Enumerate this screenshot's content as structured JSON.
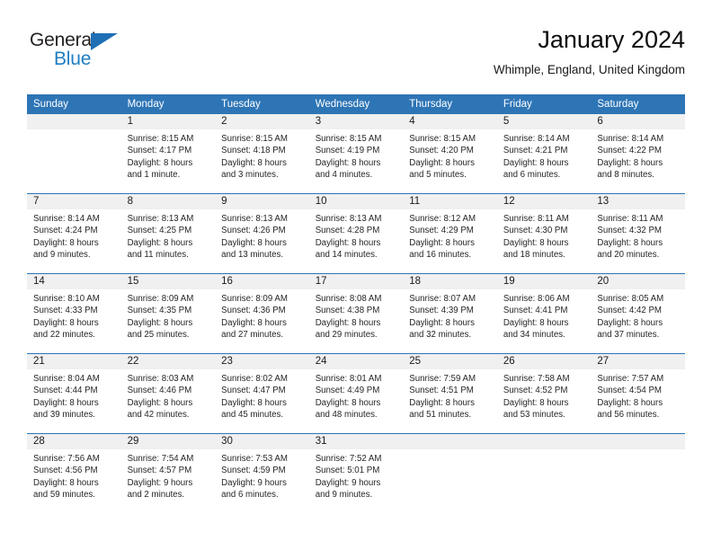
{
  "brand": {
    "name_part1": "General",
    "name_part2": "Blue",
    "triangle_icon": "triangle-icon",
    "accent_color": "#1f7ec4"
  },
  "header": {
    "title": "January 2024",
    "location": "Whimple, England, United Kingdom"
  },
  "calendar": {
    "header_bg": "#2e75b6",
    "daynum_band_bg": "#f0f0f0",
    "weekdays": [
      "Sunday",
      "Monday",
      "Tuesday",
      "Wednesday",
      "Thursday",
      "Friday",
      "Saturday"
    ],
    "weeks": [
      [
        {
          "day": "",
          "sunrise": "",
          "sunset": "",
          "daylight_line1": "",
          "daylight_line2": ""
        },
        {
          "day": "1",
          "sunrise": "Sunrise: 8:15 AM",
          "sunset": "Sunset: 4:17 PM",
          "daylight_line1": "Daylight: 8 hours",
          "daylight_line2": "and 1 minute."
        },
        {
          "day": "2",
          "sunrise": "Sunrise: 8:15 AM",
          "sunset": "Sunset: 4:18 PM",
          "daylight_line1": "Daylight: 8 hours",
          "daylight_line2": "and 3 minutes."
        },
        {
          "day": "3",
          "sunrise": "Sunrise: 8:15 AM",
          "sunset": "Sunset: 4:19 PM",
          "daylight_line1": "Daylight: 8 hours",
          "daylight_line2": "and 4 minutes."
        },
        {
          "day": "4",
          "sunrise": "Sunrise: 8:15 AM",
          "sunset": "Sunset: 4:20 PM",
          "daylight_line1": "Daylight: 8 hours",
          "daylight_line2": "and 5 minutes."
        },
        {
          "day": "5",
          "sunrise": "Sunrise: 8:14 AM",
          "sunset": "Sunset: 4:21 PM",
          "daylight_line1": "Daylight: 8 hours",
          "daylight_line2": "and 6 minutes."
        },
        {
          "day": "6",
          "sunrise": "Sunrise: 8:14 AM",
          "sunset": "Sunset: 4:22 PM",
          "daylight_line1": "Daylight: 8 hours",
          "daylight_line2": "and 8 minutes."
        }
      ],
      [
        {
          "day": "7",
          "sunrise": "Sunrise: 8:14 AM",
          "sunset": "Sunset: 4:24 PM",
          "daylight_line1": "Daylight: 8 hours",
          "daylight_line2": "and 9 minutes."
        },
        {
          "day": "8",
          "sunrise": "Sunrise: 8:13 AM",
          "sunset": "Sunset: 4:25 PM",
          "daylight_line1": "Daylight: 8 hours",
          "daylight_line2": "and 11 minutes."
        },
        {
          "day": "9",
          "sunrise": "Sunrise: 8:13 AM",
          "sunset": "Sunset: 4:26 PM",
          "daylight_line1": "Daylight: 8 hours",
          "daylight_line2": "and 13 minutes."
        },
        {
          "day": "10",
          "sunrise": "Sunrise: 8:13 AM",
          "sunset": "Sunset: 4:28 PM",
          "daylight_line1": "Daylight: 8 hours",
          "daylight_line2": "and 14 minutes."
        },
        {
          "day": "11",
          "sunrise": "Sunrise: 8:12 AM",
          "sunset": "Sunset: 4:29 PM",
          "daylight_line1": "Daylight: 8 hours",
          "daylight_line2": "and 16 minutes."
        },
        {
          "day": "12",
          "sunrise": "Sunrise: 8:11 AM",
          "sunset": "Sunset: 4:30 PM",
          "daylight_line1": "Daylight: 8 hours",
          "daylight_line2": "and 18 minutes."
        },
        {
          "day": "13",
          "sunrise": "Sunrise: 8:11 AM",
          "sunset": "Sunset: 4:32 PM",
          "daylight_line1": "Daylight: 8 hours",
          "daylight_line2": "and 20 minutes."
        }
      ],
      [
        {
          "day": "14",
          "sunrise": "Sunrise: 8:10 AM",
          "sunset": "Sunset: 4:33 PM",
          "daylight_line1": "Daylight: 8 hours",
          "daylight_line2": "and 22 minutes."
        },
        {
          "day": "15",
          "sunrise": "Sunrise: 8:09 AM",
          "sunset": "Sunset: 4:35 PM",
          "daylight_line1": "Daylight: 8 hours",
          "daylight_line2": "and 25 minutes."
        },
        {
          "day": "16",
          "sunrise": "Sunrise: 8:09 AM",
          "sunset": "Sunset: 4:36 PM",
          "daylight_line1": "Daylight: 8 hours",
          "daylight_line2": "and 27 minutes."
        },
        {
          "day": "17",
          "sunrise": "Sunrise: 8:08 AM",
          "sunset": "Sunset: 4:38 PM",
          "daylight_line1": "Daylight: 8 hours",
          "daylight_line2": "and 29 minutes."
        },
        {
          "day": "18",
          "sunrise": "Sunrise: 8:07 AM",
          "sunset": "Sunset: 4:39 PM",
          "daylight_line1": "Daylight: 8 hours",
          "daylight_line2": "and 32 minutes."
        },
        {
          "day": "19",
          "sunrise": "Sunrise: 8:06 AM",
          "sunset": "Sunset: 4:41 PM",
          "daylight_line1": "Daylight: 8 hours",
          "daylight_line2": "and 34 minutes."
        },
        {
          "day": "20",
          "sunrise": "Sunrise: 8:05 AM",
          "sunset": "Sunset: 4:42 PM",
          "daylight_line1": "Daylight: 8 hours",
          "daylight_line2": "and 37 minutes."
        }
      ],
      [
        {
          "day": "21",
          "sunrise": "Sunrise: 8:04 AM",
          "sunset": "Sunset: 4:44 PM",
          "daylight_line1": "Daylight: 8 hours",
          "daylight_line2": "and 39 minutes."
        },
        {
          "day": "22",
          "sunrise": "Sunrise: 8:03 AM",
          "sunset": "Sunset: 4:46 PM",
          "daylight_line1": "Daylight: 8 hours",
          "daylight_line2": "and 42 minutes."
        },
        {
          "day": "23",
          "sunrise": "Sunrise: 8:02 AM",
          "sunset": "Sunset: 4:47 PM",
          "daylight_line1": "Daylight: 8 hours",
          "daylight_line2": "and 45 minutes."
        },
        {
          "day": "24",
          "sunrise": "Sunrise: 8:01 AM",
          "sunset": "Sunset: 4:49 PM",
          "daylight_line1": "Daylight: 8 hours",
          "daylight_line2": "and 48 minutes."
        },
        {
          "day": "25",
          "sunrise": "Sunrise: 7:59 AM",
          "sunset": "Sunset: 4:51 PM",
          "daylight_line1": "Daylight: 8 hours",
          "daylight_line2": "and 51 minutes."
        },
        {
          "day": "26",
          "sunrise": "Sunrise: 7:58 AM",
          "sunset": "Sunset: 4:52 PM",
          "daylight_line1": "Daylight: 8 hours",
          "daylight_line2": "and 53 minutes."
        },
        {
          "day": "27",
          "sunrise": "Sunrise: 7:57 AM",
          "sunset": "Sunset: 4:54 PM",
          "daylight_line1": "Daylight: 8 hours",
          "daylight_line2": "and 56 minutes."
        }
      ],
      [
        {
          "day": "28",
          "sunrise": "Sunrise: 7:56 AM",
          "sunset": "Sunset: 4:56 PM",
          "daylight_line1": "Daylight: 8 hours",
          "daylight_line2": "and 59 minutes."
        },
        {
          "day": "29",
          "sunrise": "Sunrise: 7:54 AM",
          "sunset": "Sunset: 4:57 PM",
          "daylight_line1": "Daylight: 9 hours",
          "daylight_line2": "and 2 minutes."
        },
        {
          "day": "30",
          "sunrise": "Sunrise: 7:53 AM",
          "sunset": "Sunset: 4:59 PM",
          "daylight_line1": "Daylight: 9 hours",
          "daylight_line2": "and 6 minutes."
        },
        {
          "day": "31",
          "sunrise": "Sunrise: 7:52 AM",
          "sunset": "Sunset: 5:01 PM",
          "daylight_line1": "Daylight: 9 hours",
          "daylight_line2": "and 9 minutes."
        },
        {
          "day": "",
          "sunrise": "",
          "sunset": "",
          "daylight_line1": "",
          "daylight_line2": ""
        },
        {
          "day": "",
          "sunrise": "",
          "sunset": "",
          "daylight_line1": "",
          "daylight_line2": ""
        },
        {
          "day": "",
          "sunrise": "",
          "sunset": "",
          "daylight_line1": "",
          "daylight_line2": ""
        }
      ]
    ]
  }
}
